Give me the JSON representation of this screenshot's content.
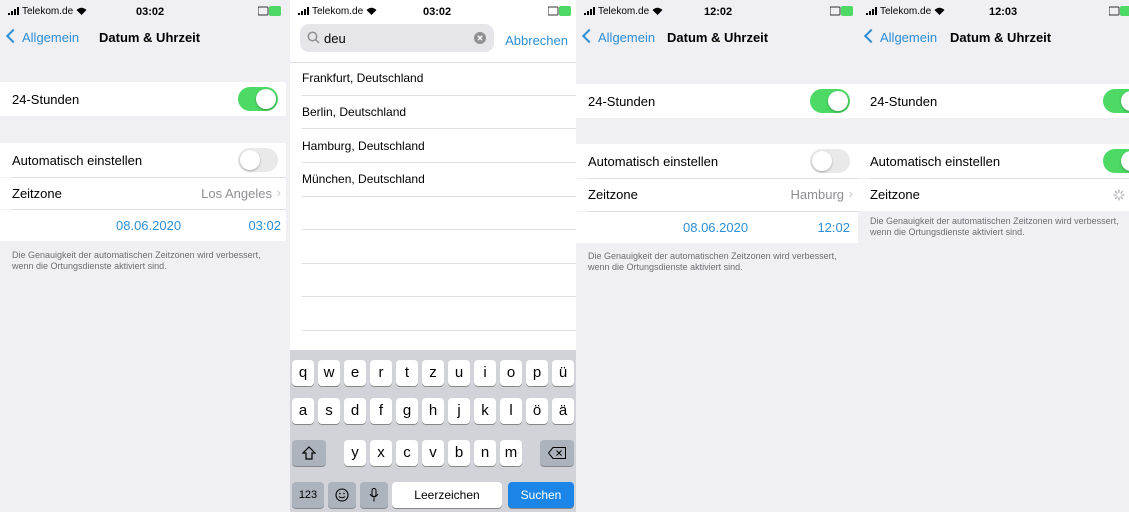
{
  "panel1": {
    "carrier": "Telekom.de",
    "time": "03:02",
    "back_label": "Allgemein",
    "title": "Datum & Uhrzeit",
    "hour24_label": "24-Stunden",
    "hour24_on": true,
    "auto_label": "Automatisch einstellen",
    "auto_on": false,
    "tz_label": "Zeitzone",
    "tz_value": "Los Angeles",
    "date": "08.06.2020",
    "clock": "03:02",
    "note": "Die Genauigkeit der automatischen Zeitzonen wird verbessert, wenn die Ortungsdienste aktiviert sind."
  },
  "panel2": {
    "carrier": "Telekom.de",
    "time": "03:02",
    "search_value": "deu",
    "cancel_label": "Abbrechen",
    "results": [
      "Frankfurt, Deutschland",
      "Berlin, Deutschland",
      "Hamburg, Deutschland",
      "München, Deutschland"
    ],
    "keyboard": {
      "row1": [
        "q",
        "w",
        "e",
        "r",
        "t",
        "z",
        "u",
        "i",
        "o",
        "p",
        "ü"
      ],
      "row2": [
        "a",
        "s",
        "d",
        "f",
        "g",
        "h",
        "j",
        "k",
        "l",
        "ö",
        "ä"
      ],
      "row3": [
        "y",
        "x",
        "c",
        "v",
        "b",
        "n",
        "m"
      ],
      "numbers_label": "123",
      "space_label": "Leerzeichen",
      "search_label": "Suchen"
    }
  },
  "panel3": {
    "carrier": "Telekom.de",
    "time": "12:02",
    "back_label": "Allgemein",
    "title": "Datum & Uhrzeit",
    "hour24_label": "24-Stunden",
    "hour24_on": true,
    "auto_label": "Automatisch einstellen",
    "auto_on": false,
    "tz_label": "Zeitzone",
    "tz_value": "Hamburg",
    "date": "08.06.2020",
    "clock": "12:02",
    "note": "Die Genauigkeit der automatischen Zeitzonen wird verbessert, wenn die Ortungsdienste aktiviert sind."
  },
  "panel4": {
    "carrier": "Telekom.de",
    "time": "12:03",
    "back_label": "Allgemein",
    "title": "Datum & Uhrzeit",
    "hour24_label": "24-Stunden",
    "hour24_on": true,
    "auto_label": "Automatisch einstellen",
    "auto_on": true,
    "tz_label": "Zeitzone",
    "note": "Die Genauigkeit der automatischen Zeitzonen wird verbessert, wenn die Ortungsdienste aktiviert sind."
  },
  "colors": {
    "accent": "#2c8ed6",
    "toggle_on": "#4cd964",
    "keyboard_blue": "#1b86e8"
  }
}
